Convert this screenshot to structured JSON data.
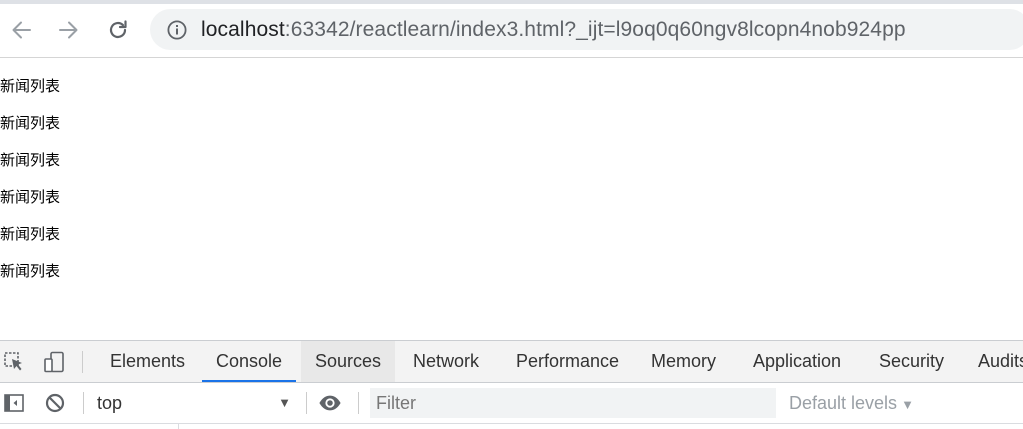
{
  "browser": {
    "url_host": "localhost",
    "url_rest": ":63342/reactlearn/index3.html?_ijt=l9oq0q60ngv8lcopn4nob924pp"
  },
  "page": {
    "news_items": [
      "新闻列表",
      "新闻列表",
      "新闻列表",
      "新闻列表",
      "新闻列表",
      "新闻列表"
    ]
  },
  "devtools": {
    "tabs": [
      "Elements",
      "Console",
      "Sources",
      "Network",
      "Performance",
      "Memory",
      "Application",
      "Security",
      "Audits"
    ],
    "active_tab": "Console",
    "hover_tab": "Sources",
    "context": "top",
    "filter_placeholder": "Filter",
    "levels": "Default levels",
    "icons": [
      "inspect-element-icon",
      "device-toolbar-icon",
      "sidebar-toggle-icon",
      "clear-console-icon",
      "live-expression-eye-icon"
    ],
    "accent_color": "#1a73e8"
  }
}
